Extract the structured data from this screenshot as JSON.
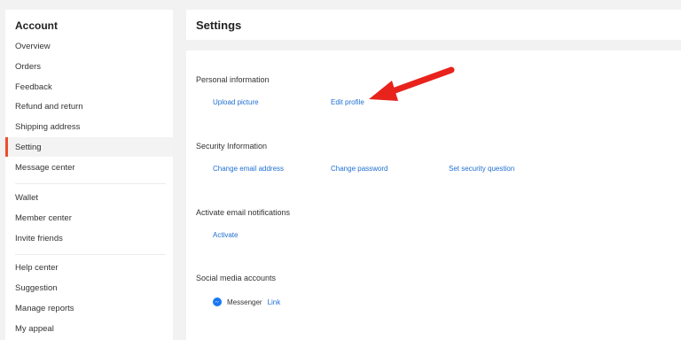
{
  "sidebar": {
    "title": "Account",
    "group1": [
      {
        "label": "Overview"
      },
      {
        "label": "Orders"
      },
      {
        "label": "Feedback"
      },
      {
        "label": "Refund and return"
      },
      {
        "label": "Shipping address"
      },
      {
        "label": "Setting"
      },
      {
        "label": "Message center"
      }
    ],
    "group2": [
      {
        "label": "Wallet"
      },
      {
        "label": "Member center"
      },
      {
        "label": "Invite friends"
      }
    ],
    "group3": [
      {
        "label": "Help center"
      },
      {
        "label": "Suggestion"
      },
      {
        "label": "Manage reports"
      },
      {
        "label": "My appeal"
      }
    ],
    "active_item": "Setting",
    "accent_color": "#ee4d2d"
  },
  "header": {
    "title": "Settings"
  },
  "personal": {
    "title": "Personal information",
    "links": [
      "Upload picture",
      "Edit profile"
    ]
  },
  "security": {
    "title": "Security Information",
    "links": [
      "Change email address",
      "Change password",
      "Set security question"
    ]
  },
  "notifications": {
    "title": "Activate email notifications",
    "links": [
      "Activate"
    ]
  },
  "social": {
    "title": "Social media accounts",
    "messenger_label": "Messenger",
    "messenger_link": "Link",
    "icon": "messenger-icon"
  },
  "annotation": {
    "arrow_color": "#e8231c",
    "points_to": "Edit profile"
  },
  "colors": {
    "link": "#1f6fd1",
    "background": "#f2f2f2"
  }
}
